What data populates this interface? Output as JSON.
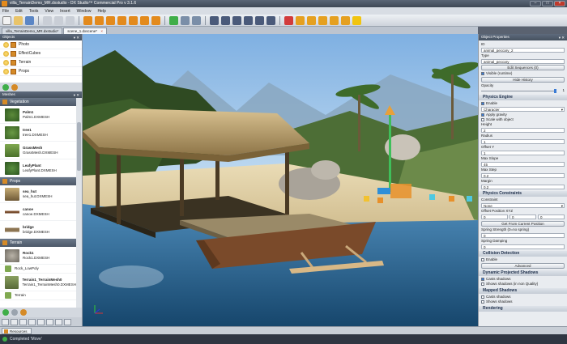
{
  "window": {
    "title": "villa_TerrainDemo_MR.dxstudio - DX Studio™ Commercial Pro v 3.1.6"
  },
  "menu": [
    "File",
    "Edit",
    "Tools",
    "View",
    "Insert",
    "Window",
    "Help"
  ],
  "document_tabs": [
    {
      "label": "villa_TerrainDemo_MR.dxstudio*",
      "active": false
    },
    {
      "label": "scene_1.dxscene*",
      "active": true
    }
  ],
  "objects_panel": {
    "title": "Objects",
    "items": [
      "Photo",
      "EffectCubes",
      "Terrain",
      "Props"
    ]
  },
  "meshes_panel": {
    "title": "Meshes",
    "categories": [
      {
        "name": "Vegetation",
        "items": [
          {
            "name": "Palm1",
            "file": "Palm1.DXMESH"
          },
          {
            "name": "tree1",
            "file": "tree1.DXMESH"
          },
          {
            "name": "GrassMesh",
            "file": "GrassMesh.DXMESH"
          },
          {
            "name": "LeafyPlant",
            "file": "LeafyPlant.DXMESH"
          }
        ]
      },
      {
        "name": "Props",
        "items": [
          {
            "name": "sea_hut",
            "file": "sea_hut.DXMESH"
          },
          {
            "name": "canoe",
            "file": "canoe.DXMESH"
          },
          {
            "name": "bridge",
            "file": "bridge.DXMESH"
          }
        ]
      },
      {
        "name": "Terrain",
        "items": [
          {
            "name": "Rock1",
            "file": "Rock1.DXMESH"
          },
          {
            "name": "Rock_LowPoly",
            "file": ""
          },
          {
            "name": "Terrain1_TerrainMesh0",
            "file": "Terrain1_TerrainMesh0.DXMESH"
          },
          {
            "name": "Terrain",
            "file": ""
          }
        ]
      }
    ]
  },
  "properties_panel": {
    "title": "Object Properties",
    "id_label": "ID",
    "id_value": "animal_peccary_2",
    "type_label": "Type",
    "type_value": "animal_peccary",
    "edit_sequences_button": "Edit Sequences (0)",
    "visible_label": "Visible (runtime)",
    "hide_history_button": "Hide History",
    "opacity_label": "Opacity",
    "opacity_value": "1",
    "physics_engine": {
      "title": "Physics Engine",
      "enable_label": "Enable",
      "type_value": "Character",
      "apply_gravity_label": "Apply gravity",
      "scale_with_object_label": "Scale with object",
      "height_label": "Height",
      "height_value": "2",
      "radius_label": "Radius",
      "radius_value": "1",
      "offset_y_label": "Offset Y",
      "offset_y_value": "1",
      "max_slope_label": "Max Slope",
      "max_slope_value": "45",
      "max_step_label": "Max Step",
      "max_step_value": "0.2",
      "margin_label": "Margin",
      "margin_value": "0.2"
    },
    "physics_constraints": {
      "title": "Physics Constraints",
      "constraint_label": "Constraint",
      "constraint_value": "None",
      "offset_position_label": "Offset Position XYZ",
      "offset_values": [
        "0",
        "0",
        "0"
      ],
      "get_position_button": "Get From Current Position",
      "spring_strength_label": "Spring Strength (0=no spring)",
      "spring_strength_value": "0",
      "spring_damping_label": "Spring Damping",
      "spring_damping_value": "0"
    },
    "collision_detection": {
      "title": "Collision Detection",
      "enable_label": "Enable",
      "advanced_button": "Advanced"
    },
    "dynamic_shadows": {
      "title": "Dynamic Projected Shadows",
      "casts_label": "Casts shadows",
      "shows_label": "Shows shadows (in non Quality)"
    },
    "mapped_shadows": {
      "title": "Mapped Shadows",
      "casts_label": "Casts shadows",
      "shows_label": "Shows shadows"
    },
    "rendering": {
      "title": "Rendering"
    }
  },
  "bottom_tabs": [
    "Resources"
  ],
  "status": "Completed 'Move'",
  "colors": {
    "accent": "#3a7bd5",
    "panel_header": "#4d5868",
    "status_ok": "#3fae49"
  }
}
